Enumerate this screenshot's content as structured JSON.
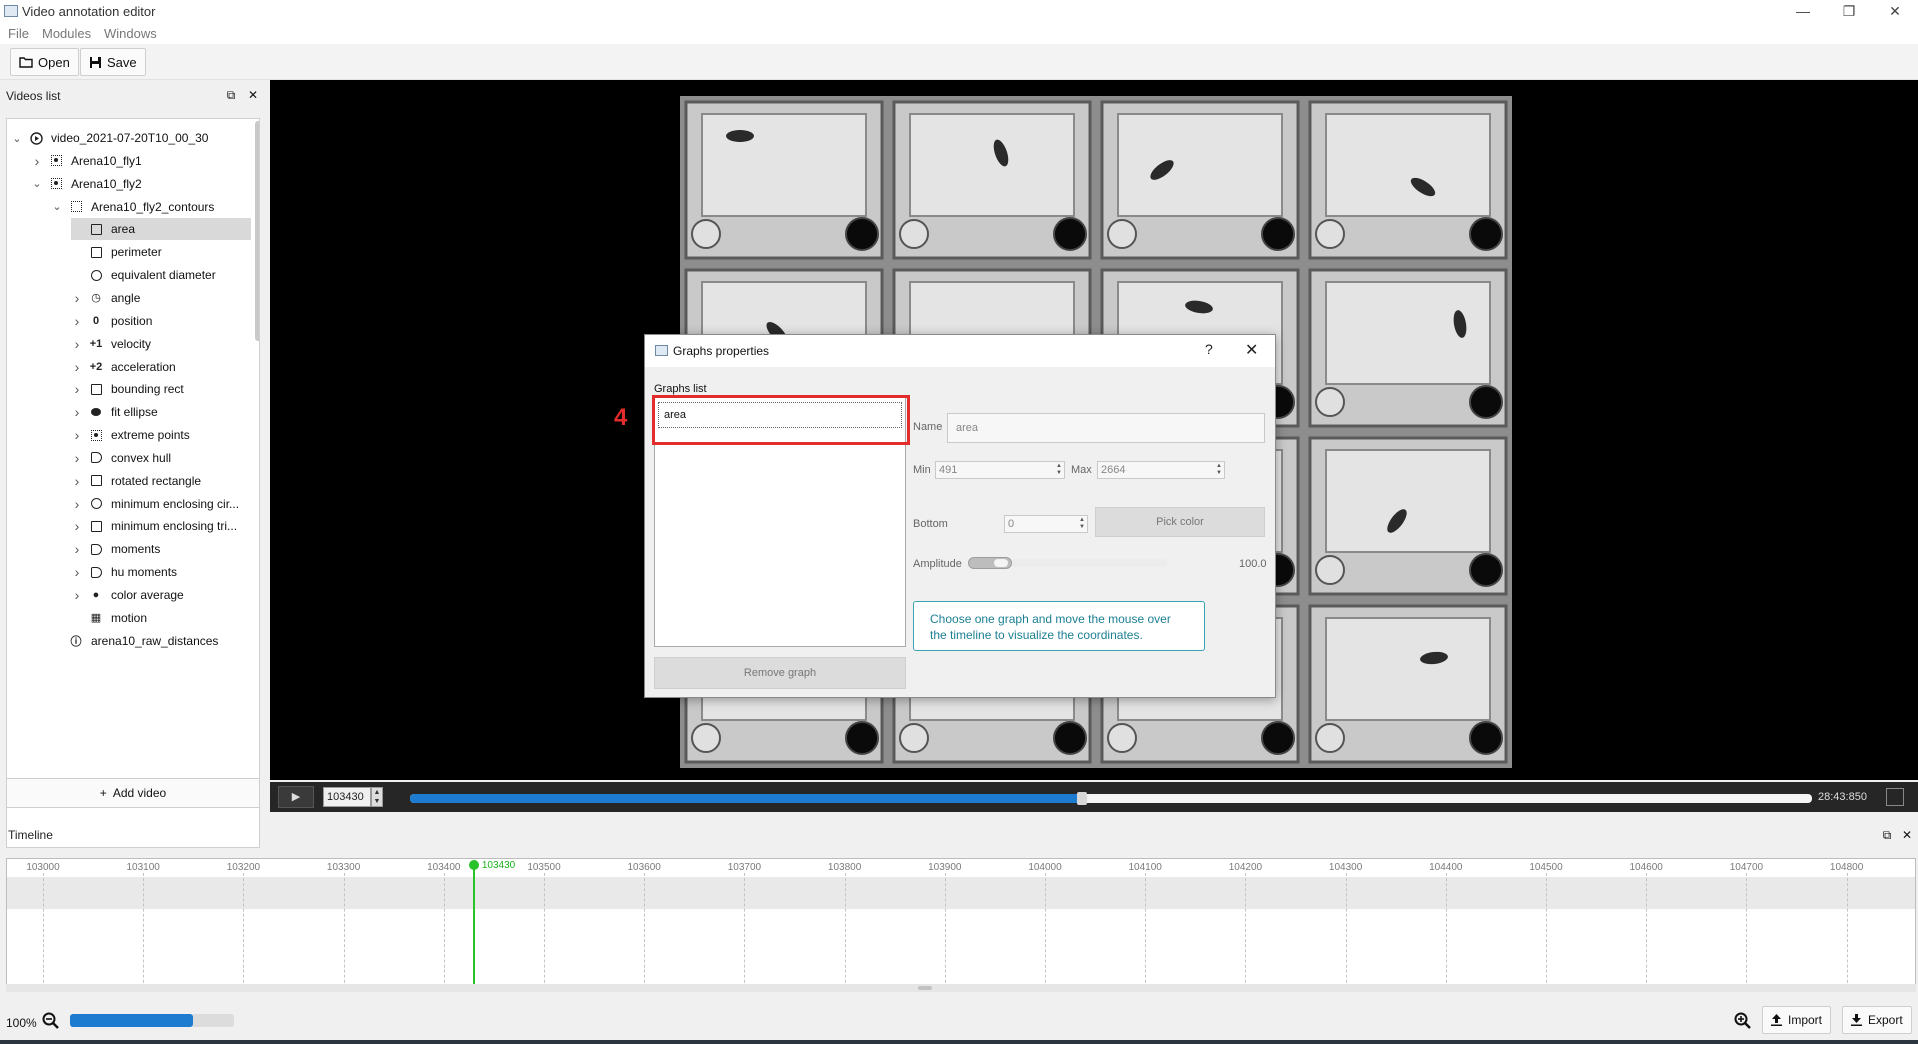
{
  "window": {
    "title": "Video annotation editor",
    "controls": [
      "—",
      "❐",
      "✕"
    ]
  },
  "menu": [
    "File",
    "Modules",
    "Windows"
  ],
  "toolbar": {
    "open_label": "Open",
    "save_label": "Save"
  },
  "videos_panel": {
    "title": "Videos list",
    "add_video_label": "Add video",
    "tree": [
      {
        "label": "video_2021-07-20T10_00_30",
        "depth": 0,
        "chevron": "down",
        "icon": "play-circle",
        "glyph": "▶"
      },
      {
        "label": "Arena10_fly1",
        "depth": 1,
        "chevron": "right",
        "icon": "target",
        "glyph": ""
      },
      {
        "label": "Arena10_fly2",
        "depth": 1,
        "chevron": "down",
        "icon": "target",
        "glyph": ""
      },
      {
        "label": "Arena10_fly2_contours",
        "depth": 2,
        "chevron": "down",
        "icon": "dashed-square",
        "glyph": ""
      },
      {
        "label": "area",
        "depth": 3,
        "chevron": "",
        "icon": "square",
        "glyph": "",
        "selected": true
      },
      {
        "label": "perimeter",
        "depth": 3,
        "chevron": "",
        "icon": "square",
        "glyph": ""
      },
      {
        "label": "equivalent diameter",
        "depth": 3,
        "chevron": "",
        "icon": "circle",
        "glyph": ""
      },
      {
        "label": "angle",
        "depth": 3,
        "chevron": "right",
        "icon": "angle",
        "glyph": "◷"
      },
      {
        "label": "position",
        "depth": 3,
        "chevron": "right",
        "icon": "position",
        "glyph": "0"
      },
      {
        "label": "velocity",
        "depth": 3,
        "chevron": "right",
        "icon": "velocity",
        "glyph": "+1"
      },
      {
        "label": "acceleration",
        "depth": 3,
        "chevron": "right",
        "icon": "acceleration",
        "glyph": "+2"
      },
      {
        "label": "bounding rect",
        "depth": 3,
        "chevron": "right",
        "icon": "square",
        "glyph": ""
      },
      {
        "label": "fit ellipse",
        "depth": 3,
        "chevron": "right",
        "icon": "filled-ellipse",
        "glyph": ""
      },
      {
        "label": "extreme points",
        "depth": 3,
        "chevron": "right",
        "icon": "target",
        "glyph": ""
      },
      {
        "label": "convex hull",
        "depth": 3,
        "chevron": "right",
        "icon": "hull",
        "glyph": ""
      },
      {
        "label": "rotated rectangle",
        "depth": 3,
        "chevron": "right",
        "icon": "square",
        "glyph": ""
      },
      {
        "label": "minimum enclosing cir...",
        "depth": 3,
        "chevron": "right",
        "icon": "circle",
        "glyph": ""
      },
      {
        "label": "minimum enclosing tri...",
        "depth": 3,
        "chevron": "right",
        "icon": "square",
        "glyph": ""
      },
      {
        "label": "moments",
        "depth": 3,
        "chevron": "right",
        "icon": "hull",
        "glyph": ""
      },
      {
        "label": "hu moments",
        "depth": 3,
        "chevron": "right",
        "icon": "hull",
        "glyph": ""
      },
      {
        "label": "color average",
        "depth": 3,
        "chevron": "right",
        "icon": "palette",
        "glyph": "●"
      },
      {
        "label": "motion",
        "depth": 3,
        "chevron": "",
        "icon": "grid",
        "glyph": "▦"
      },
      {
        "label": "arena10_raw_distances",
        "depth": 2,
        "chevron": "",
        "icon": "info",
        "glyph": "ⓘ"
      }
    ]
  },
  "player": {
    "frame": "103430",
    "time": "28:43:850",
    "progress": 0.478
  },
  "timeline": {
    "title": "Timeline",
    "ticks": [
      "103000",
      "103100",
      "103200",
      "103300",
      "103400",
      "103500",
      "103600",
      "103700",
      "103800",
      "103900",
      "104000",
      "104100",
      "104200",
      "104300",
      "104400",
      "104500",
      "104600",
      "104700",
      "104800"
    ],
    "playhead_label": "103430"
  },
  "statusbar": {
    "zoom": "100%",
    "zoom_level": 0.75,
    "import_label": "Import",
    "export_label": "Export"
  },
  "dialog": {
    "title": "Graphs properties",
    "help": "?",
    "graphs_list_label": "Graphs list",
    "graphs": [
      "area"
    ],
    "remove_label": "Remove graph",
    "name_label": "Name",
    "name_value": "area",
    "min_label": "Min",
    "min_value": "491",
    "max_label": "Max",
    "max_value": "2664",
    "bottom_label": "Bottom",
    "bottom_value": "0",
    "pick_color_label": "Pick color",
    "amplitude_label": "Amplitude",
    "amplitude_value": "100.0",
    "info_text": "Choose one graph and move the mouse over the timeline to visualize the coordinates."
  },
  "annotation": {
    "step": "4",
    "color": "#e32d2d"
  },
  "colors": {
    "accent": "#1e7cd0",
    "playhead": "#29c329",
    "info": "#1c7f93"
  }
}
